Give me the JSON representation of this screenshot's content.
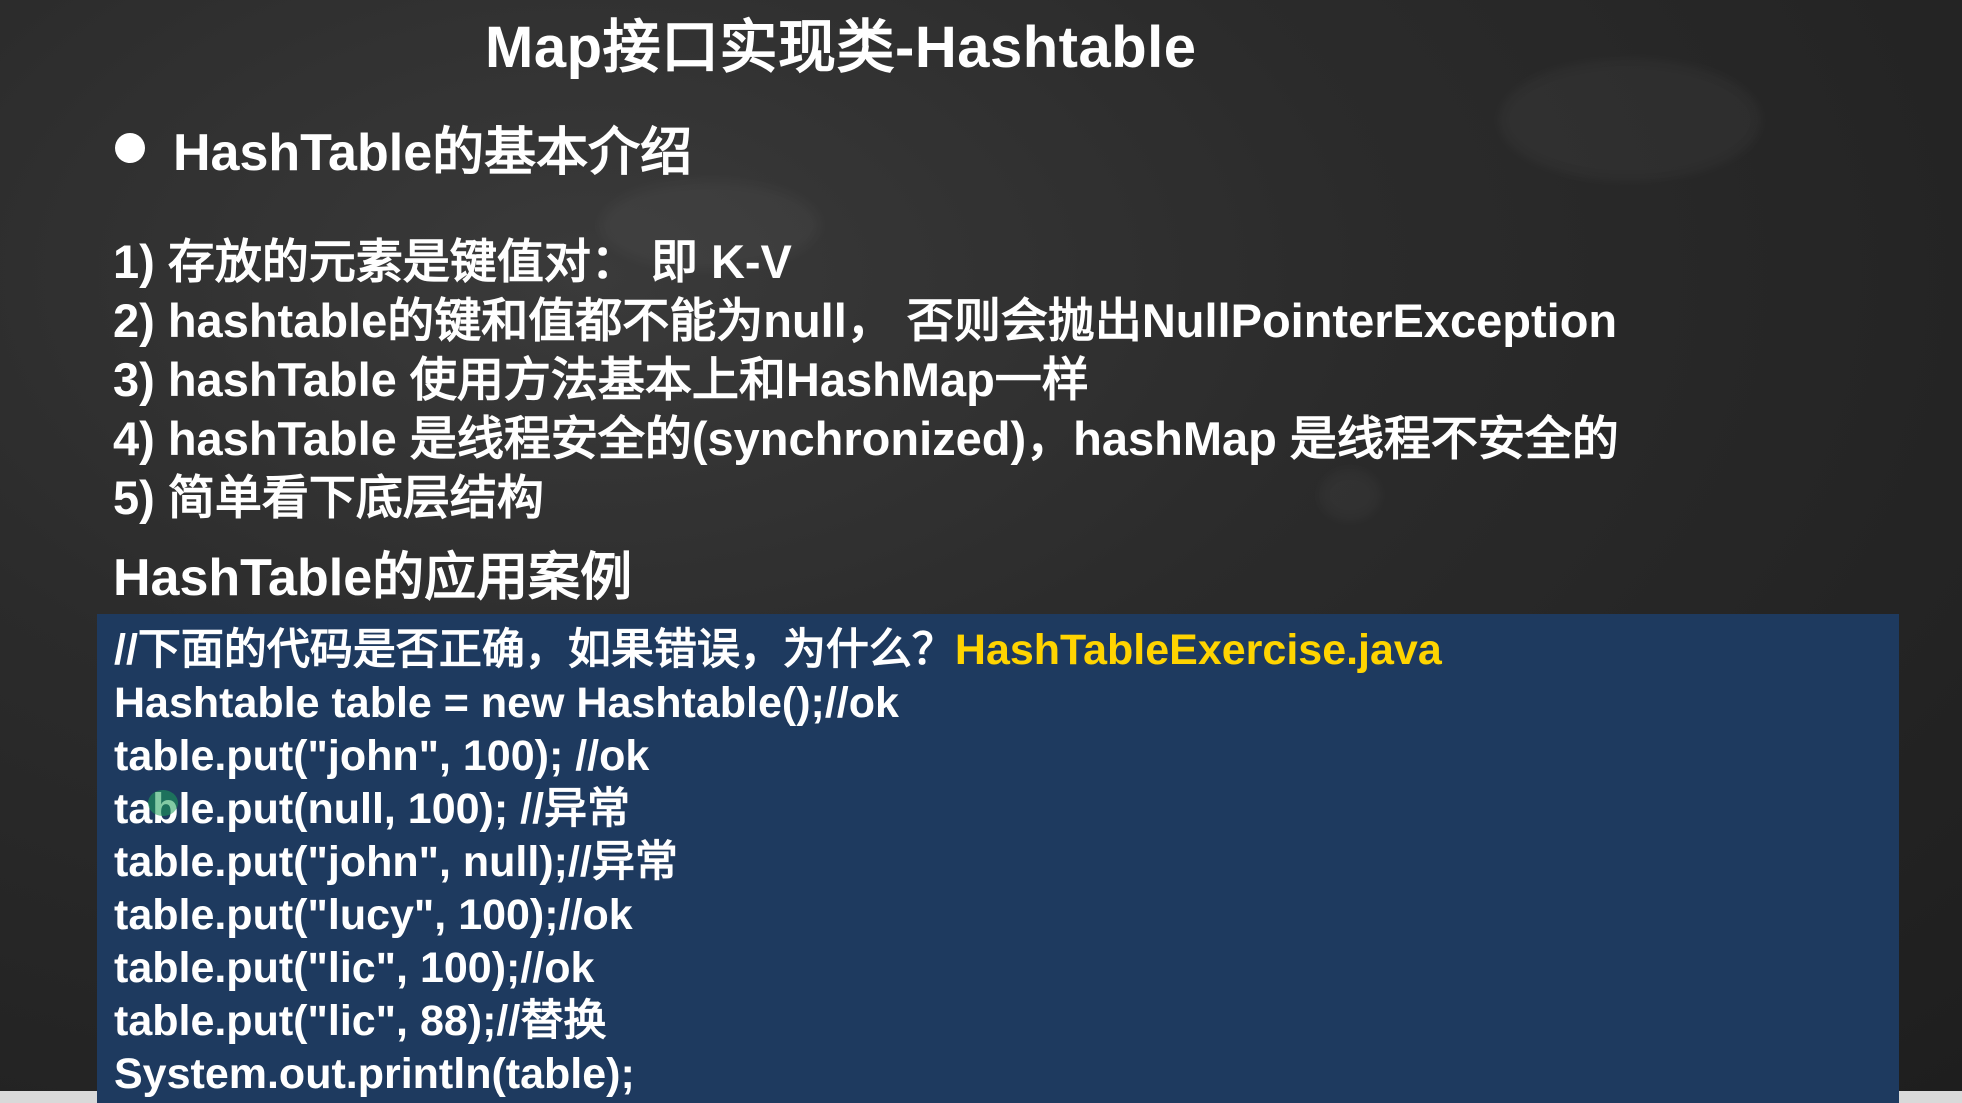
{
  "slide": {
    "title": "Map接口实现类-Hashtable",
    "section_heading": "HashTable的基本介绍",
    "points": [
      "1) 存放的元素是键值对： 即 K-V",
      "2) hashtable的键和值都不能为null， 否则会抛出NullPointerException",
      "3) hashTable 使用方法基本上和HashMap一样",
      "4) hashTable 是线程安全的(synchronized)，hashMap 是线程不安全的",
      "5) 简单看下底层结构"
    ],
    "application_heading": "HashTable的应用案例"
  },
  "code": {
    "comment_prefix": "//下面的代码是否正确，如果错误，为什么？",
    "filename": "HashTableExercise.java",
    "lines": [
      "Hashtable table = new Hashtable();//ok",
      "table.put(\"john\", 100); //ok",
      "table.put(null, 100); //异常",
      "table.put(\"john\", null);//异常",
      "table.put(\"lucy\", 100);//ok",
      "table.put(\"lic\", 100);//ok",
      "table.put(\"lic\", 88);//替换",
      "System.out.println(table);"
    ]
  },
  "colors": {
    "background": "#2b2b2b",
    "code_background": "#1e3a5f",
    "filename_highlight": "#ffd400",
    "text": "#ffffff"
  }
}
